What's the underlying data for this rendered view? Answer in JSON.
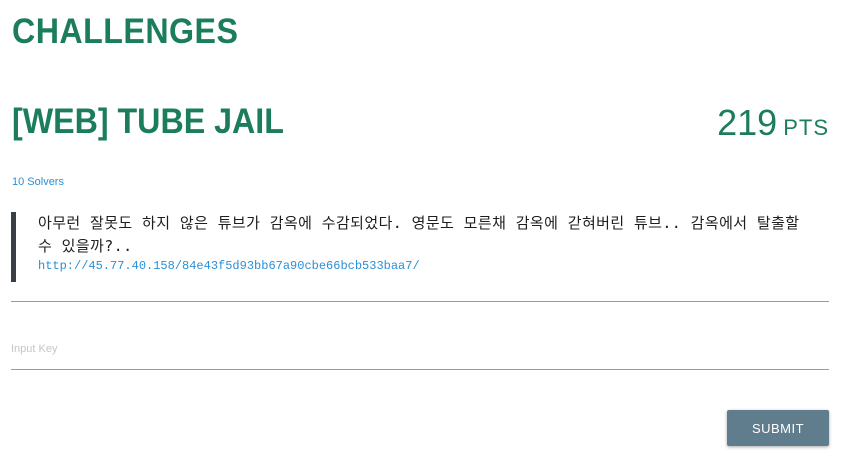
{
  "page": {
    "title": "CHALLENGES"
  },
  "challenge": {
    "title": "[WEB] TUBE JAIL",
    "points": "219",
    "points_unit": "PTS",
    "solvers": "10 Solvers",
    "description": "아무런 잘못도 하지 않은 튜브가 감옥에 수감되었다. 영문도 모른채 감옥에 갇혀버린 튜브.. 감옥에서 탈출할 수 있을까?..",
    "link": "http://45.77.40.158/84e43f5d93bb67a90cbe66bcb533baa7/"
  },
  "form": {
    "key_placeholder": "Input Key",
    "submit_label": "SUBMIT"
  },
  "colors": {
    "accent_green": "#1c7d5c",
    "link_blue": "#2a8fd6",
    "button": "#5f7d8c"
  }
}
